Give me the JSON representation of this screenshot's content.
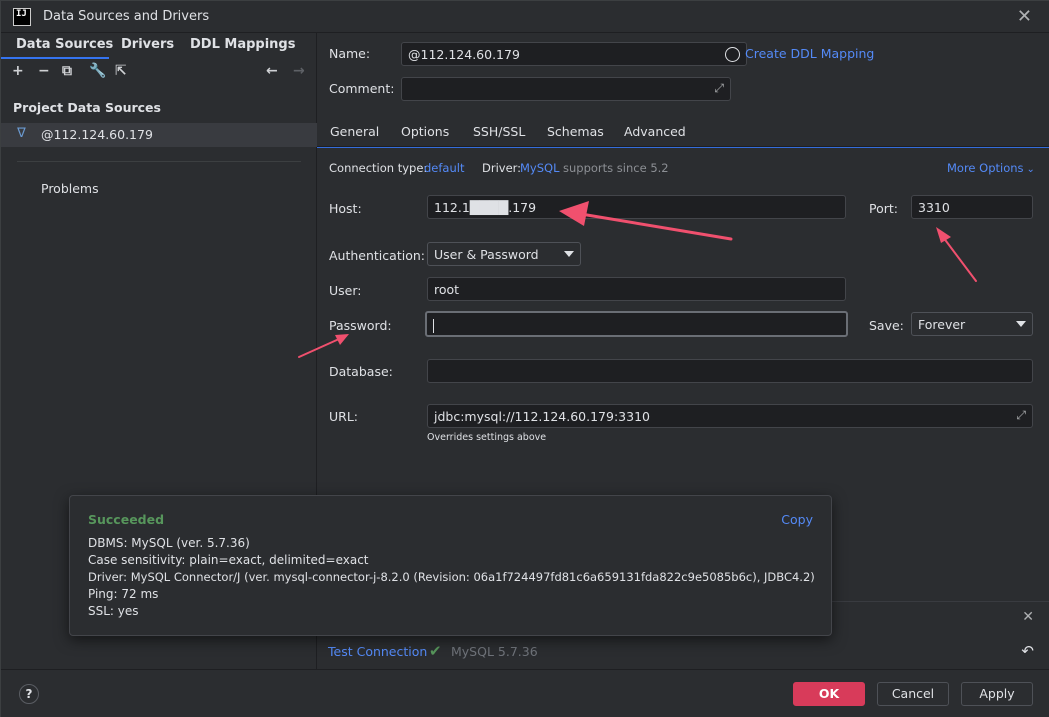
{
  "window": {
    "title": "Data Sources and Drivers",
    "app_icon_text": "IJ"
  },
  "left": {
    "tabs": [
      {
        "label": "Data Sources"
      },
      {
        "label": "Drivers"
      },
      {
        "label": "DDL Mappings"
      }
    ],
    "section_title": "Project Data Sources",
    "data_source": "@112.124.60.179",
    "problems": "Problems"
  },
  "form": {
    "name_label": "Name:",
    "name_value": "@112.124.60.179",
    "create_ddl_link": "Create DDL Mapping",
    "comment_label": "Comment:",
    "comment_value": "",
    "tabs": [
      {
        "label": "General"
      },
      {
        "label": "Options"
      },
      {
        "label": "SSH/SSL"
      },
      {
        "label": "Schemas"
      },
      {
        "label": "Advanced"
      }
    ],
    "connection_type_label": "Connection type:",
    "connection_type_value": "default",
    "driver_label": "Driver:",
    "driver_value": "MySQL",
    "driver_note": "supports since 5.2",
    "more_options": "More Options",
    "host_label": "Host:",
    "host_value": "112.1████.179",
    "port_label": "Port:",
    "port_value": "3310",
    "auth_label": "Authentication:",
    "auth_value": "User & Password",
    "user_label": "User:",
    "user_value": "root",
    "password_label": "Password:",
    "password_value": "",
    "save_label": "Save:",
    "save_value": "Forever",
    "database_label": "Database:",
    "database_value": "",
    "url_label": "URL:",
    "url_value": "jdbc:mysql://112.124.60.179:3310",
    "url_note": "Overrides settings above"
  },
  "popup": {
    "title": "Succeeded",
    "copy": "Copy",
    "lines": [
      "DBMS: MySQL (ver. 5.7.36)",
      "Case sensitivity: plain=exact, delimited=exact",
      "Driver: MySQL Connector/J (ver. mysql-connector-j-8.2.0 (Revision: 06a1f724497fd81c6a659131fda822c9e5085b6c), JDBC4.2)",
      "Ping: 72 ms",
      "SSL: yes"
    ]
  },
  "test": {
    "label": "Test Connection",
    "version": "MySQL 5.7.36"
  },
  "footer": {
    "help": "?",
    "ok": "OK",
    "cancel": "Cancel",
    "apply": "Apply"
  },
  "colors": {
    "accent": "#3574f0",
    "link": "#548af7",
    "success": "#57965c",
    "ok_button": "#d83b5a",
    "annotation_arrow": "#f0506e"
  }
}
